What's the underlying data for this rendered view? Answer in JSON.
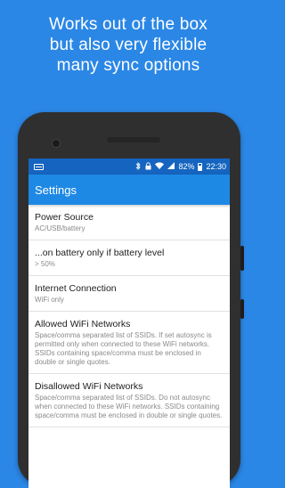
{
  "headline": {
    "line1": "Works out of the box",
    "line2": "but also very flexible",
    "line3": "many sync options"
  },
  "statusbar": {
    "bluetooth_icon": "bluetooth-icon",
    "lock_icon": "lock-icon",
    "wifi_icon": "wifi-icon",
    "signal_icon": "signal-icon",
    "battery_percent": "82%",
    "time": "22:30"
  },
  "appbar": {
    "title": "Settings"
  },
  "preferences": [
    {
      "title": "Power Source",
      "summary": "AC/USB/battery"
    },
    {
      "title": "...on battery only if battery level",
      "summary": "> 50%"
    },
    {
      "title": "Internet Connection",
      "summary": "WiFi only"
    },
    {
      "title": "Allowed WiFi Networks",
      "summary": "Space/comma separated list of SSIDs. If set autosync is permitted only when connected to these WiFi networks. SSIDs containing space/comma must be enclosed in double or single quotes."
    },
    {
      "title": "Disallowed WiFi Networks",
      "summary": "Space/comma separated list of SSIDs. Do not autosync when connected to these WiFi networks. SSIDs containing space/comma must be enclosed in double or single quotes."
    }
  ],
  "colors": {
    "background": "#2b87e6",
    "statusbar": "#1565c0",
    "appbar": "#1e88e5"
  }
}
